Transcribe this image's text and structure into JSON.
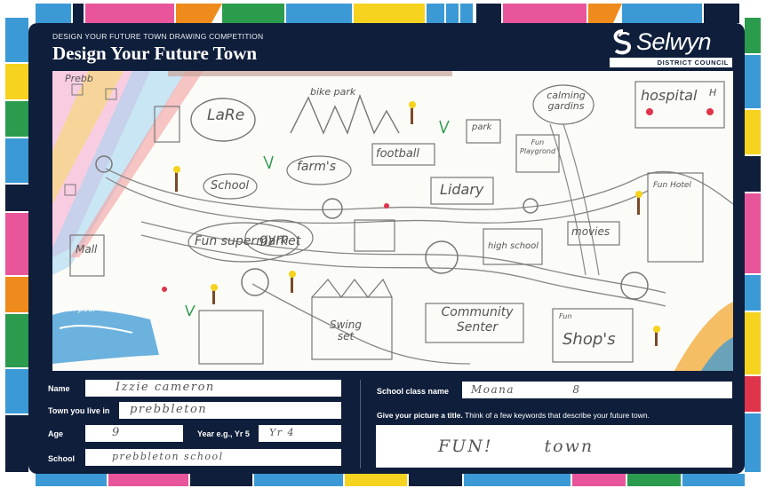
{
  "header": {
    "competition": "DESIGN YOUR FUTURE TOWN DRAWING COMPETITION",
    "title": "Design Your Future Town"
  },
  "logo": {
    "name": "Selwyn",
    "subtitle": "DISTRICT COUNCIL",
    "icon": "selwyn-swirl-icon"
  },
  "drawing": {
    "labels": {
      "townsign": "Prebb",
      "lake": "LaRe",
      "bike_park": "bike park",
      "calming": "calming gardins",
      "hospital": "hospital",
      "hospital_h": "H",
      "park": "park",
      "fun_playground": "Fun Playgrond",
      "football": "football",
      "school": "School",
      "farms": "farm's",
      "library": "Lidary",
      "fun_hotel": "Fun Hotel",
      "mall": "Mall",
      "supermarket": "Fun supermarket",
      "gym": "gym",
      "movies": "movies",
      "high_school": "high school",
      "pool": "Fun pool",
      "swing_set": "Swing set",
      "community": "Community Senter",
      "shops": "Shop's",
      "fun_small": "Fun"
    }
  },
  "form": {
    "name_label": "Name",
    "name_value": "Izzie cameron",
    "town_label": "Town you live in",
    "town_value": "prebbleton",
    "age_label": "Age",
    "age_value": "9",
    "year_label": "Year e.g., Yr 5",
    "year_value": "Yr 4",
    "school_label": "School",
    "school_value": "prebbleton school",
    "class_label": "School class name",
    "class_value": "Moana 8",
    "title_prompt_bold": "Give your picture a title.",
    "title_prompt_rest": " Think of a few keywords that describe your future town.",
    "title_value": "FUN! town"
  },
  "colors": {
    "navy": "#0f1e3a",
    "red": "#e0344b",
    "blue": "#3b9ad6",
    "yellow": "#f5d31f",
    "orange": "#ef8a1d",
    "pink": "#e8559b",
    "green": "#2b9b4e",
    "lightblue": "#8fd3ee"
  }
}
